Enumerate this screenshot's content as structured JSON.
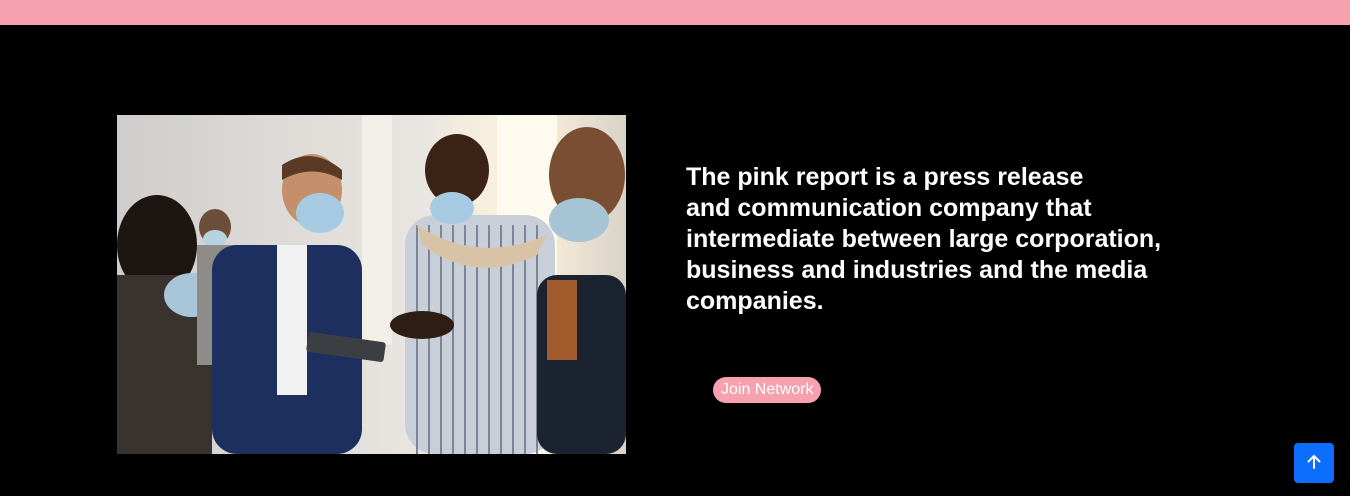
{
  "header": {
    "bar_color": "#f7a1ae"
  },
  "hero": {
    "image_alt": "Business people wearing face masks talking at a conference",
    "headline_lines": [
      "The pink report is a press release",
      "and communication company that",
      "intermediate between large corporation,",
      "business and industries and the media",
      "companies."
    ],
    "join_button_label": "Join Network"
  },
  "scroll_top": {
    "icon": "arrow-up-icon",
    "color": "#0d6efd"
  }
}
